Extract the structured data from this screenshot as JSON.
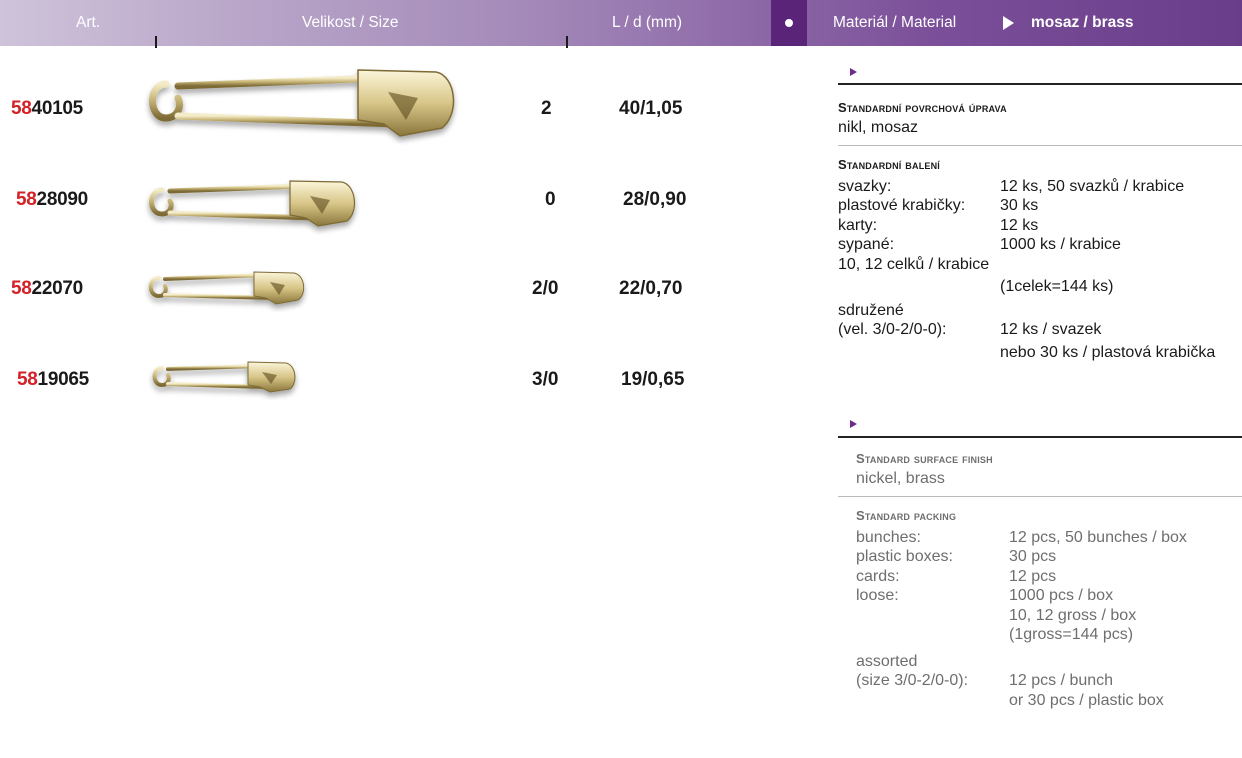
{
  "header": {
    "art": "Art.",
    "size": "Velikost / Size",
    "ld": "L / d (mm)",
    "material": "Materiál / Material",
    "material_value": "mosaz / brass",
    "colors": {
      "accent": "#6a3d8b",
      "code_prefix": "#d42127"
    }
  },
  "products": [
    {
      "prefix": "58",
      "number": "40105",
      "size": "2",
      "ld": "40/1,05"
    },
    {
      "prefix": "58",
      "number": "28090",
      "size": "0",
      "ld": "28/0,90"
    },
    {
      "prefix": "58",
      "number": "22070",
      "size": "2/0",
      "ld": "22/0,70"
    },
    {
      "prefix": "58",
      "number": "19065",
      "size": "3/0",
      "ld": "19/0,65"
    }
  ],
  "cz": {
    "finish_title": "Standardní povrchová úprava",
    "finish_value": "nikl, mosaz",
    "packing_title": "Standardní balení",
    "rows": [
      {
        "label": "svazky:",
        "value": "12 ks, 50 svazků / krabice"
      },
      {
        "label": "plastové krabičky:",
        "value": "30 ks"
      },
      {
        "label": "karty:",
        "value": "12 ks"
      },
      {
        "label": "sypané:",
        "value": "1000 ks / krabice"
      },
      {
        "label": "10, 12 celků / krabice",
        "value": ""
      },
      {
        "label": "",
        "value": "(1celek=144 ks)"
      },
      {
        "label": "sdružené",
        "value": ""
      },
      {
        "label": "(vel. 3/0-2/0-0):",
        "value": "12 ks / svazek"
      },
      {
        "label": "",
        "value": "nebo 30 ks / plastová krabička"
      }
    ]
  },
  "en": {
    "finish_title": "Standard surface finish",
    "finish_value": "nickel, brass",
    "packing_title": "Standard packing",
    "rows": [
      {
        "label": "bunches:",
        "value": "12 pcs, 50 bunches / box"
      },
      {
        "label": "plastic boxes:",
        "value": "30 pcs"
      },
      {
        "label": "cards:",
        "value": "12 pcs"
      },
      {
        "label": "loose:",
        "value": "1000 pcs / box"
      },
      {
        "label": "",
        "value": "10, 12 gross / box"
      },
      {
        "label": "",
        "value": "(1gross=144 pcs)"
      },
      {
        "label": "assorted",
        "value": ""
      },
      {
        "label": "(size 3/0-2/0-0):",
        "value": "12 pcs / bunch"
      },
      {
        "label": "",
        "value": "or 30 pcs / plastic box"
      }
    ]
  }
}
